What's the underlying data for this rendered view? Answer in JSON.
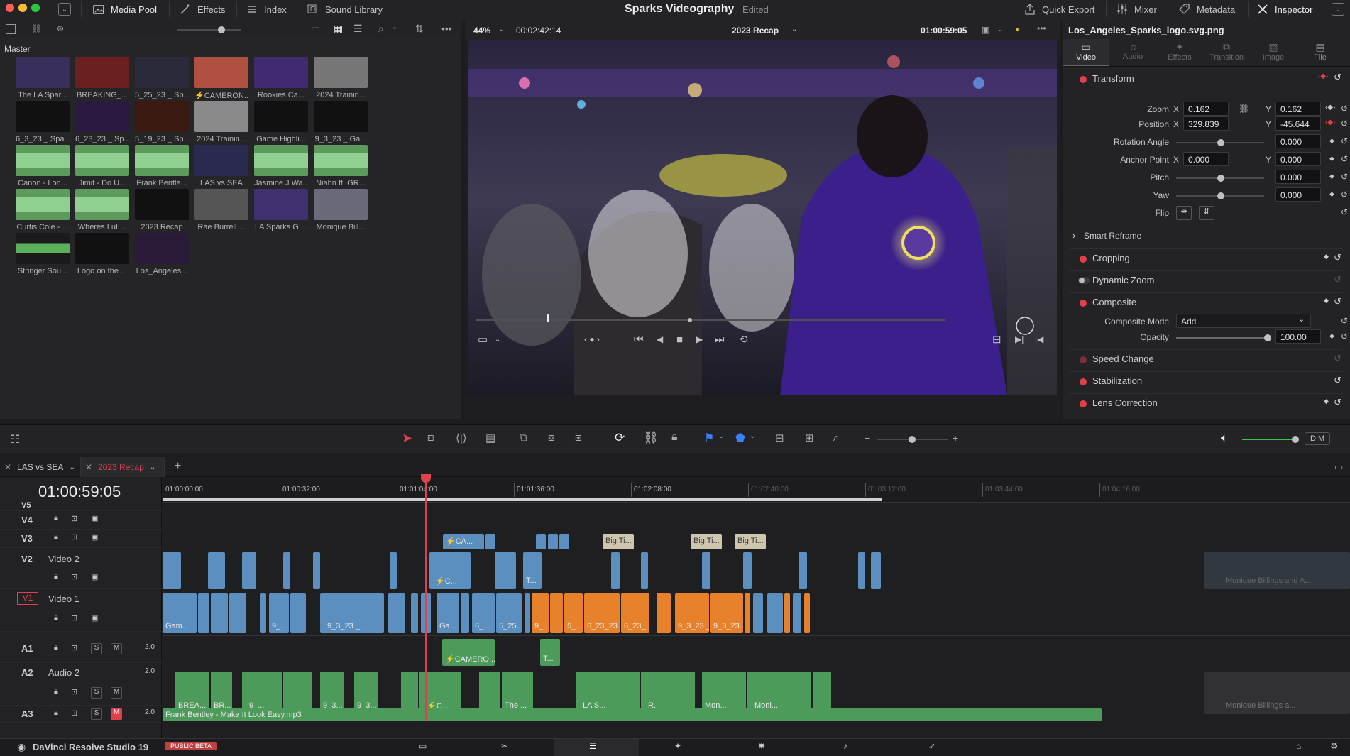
{
  "app": {
    "name": "DaVinci Resolve Studio 19",
    "badge": "PUBLIC BETA",
    "project": "Sparks Videography",
    "status": "Edited"
  },
  "topbar": {
    "media_pool": "Media Pool",
    "effects": "Effects",
    "index": "Index",
    "sound_library": "Sound Library",
    "quick_export": "Quick Export",
    "mixer": "Mixer",
    "metadata": "Metadata",
    "inspector": "Inspector"
  },
  "media_pool": {
    "bin": "Master",
    "clips": [
      {
        "label": "The LA Spar..."
      },
      {
        "label": "BREAKING_..."
      },
      {
        "label": "5_25_23 _ Sp..."
      },
      {
        "label": "⚡CAMERON..."
      },
      {
        "label": "Rookies Ca..."
      },
      {
        "label": "2024 Trainin..."
      },
      {
        "label": "6_3_23 _ Spa..."
      },
      {
        "label": "6_23_23 _ Sp..."
      },
      {
        "label": "5_19_23 _ Sp..."
      },
      {
        "label": "2024 Trainin..."
      },
      {
        "label": "Game Highli..."
      },
      {
        "label": "9_3_23 _ Ga..."
      },
      {
        "label": "Canon - Lon..."
      },
      {
        "label": "Jimit - Do U..."
      },
      {
        "label": "Frank Bentle..."
      },
      {
        "label": "LAS vs SEA"
      },
      {
        "label": "Jasmine J Wa..."
      },
      {
        "label": "Niahn ft. GR..."
      },
      {
        "label": "Curtis Cole - ..."
      },
      {
        "label": "Wheres LuL..."
      },
      {
        "label": "2023 Recap"
      },
      {
        "label": "Rae Burrell ..."
      },
      {
        "label": "LA Sparks G ..."
      },
      {
        "label": "Monique Bill..."
      },
      {
        "label": "Stringer Sou..."
      },
      {
        "label": "Logo on the ..."
      },
      {
        "label": "Los_Angeles..."
      }
    ]
  },
  "viewer": {
    "zoom": "44%",
    "duration": "00:02:42:14",
    "timeline": "2023 Recap",
    "timecode": "01:00:59:05"
  },
  "inspector": {
    "clip_name": "Los_Angeles_Sparks_logo.svg.png",
    "tabs": [
      "Video",
      "Audio",
      "Effects",
      "Transition",
      "Image",
      "File"
    ],
    "transform": "Transform",
    "zoom_label": "Zoom",
    "zoom_x": "0.162",
    "zoom_y": "0.162",
    "position_label": "Position",
    "pos_x": "329.839",
    "pos_y": "-45.644",
    "rotation_label": "Rotation Angle",
    "rotation": "0.000",
    "anchor_label": "Anchor Point",
    "anchor_x": "0.000",
    "anchor_y": "0.000",
    "pitch_label": "Pitch",
    "pitch": "0.000",
    "yaw_label": "Yaw",
    "yaw": "0.000",
    "flip_label": "Flip",
    "x": "X",
    "y": "Y",
    "smart_reframe": "Smart Reframe",
    "cropping": "Cropping",
    "dynamic_zoom": "Dynamic Zoom",
    "composite": "Composite",
    "composite_mode_label": "Composite Mode",
    "composite_mode": "Add",
    "opacity_label": "Opacity",
    "opacity": "100.00",
    "speed_change": "Speed Change",
    "stabilization": "Stabilization",
    "lens_correction": "Lens Correction"
  },
  "timeline_tabs": [
    {
      "label": "LAS vs SEA"
    },
    {
      "label": "2023 Recap"
    }
  ],
  "timeline": {
    "timecode": "01:00:59:05",
    "ruler": [
      "01:00:00:00",
      "01:00:32:00",
      "01:01:04:00",
      "01:01:36:00",
      "01:02:08:00",
      "01:02:40:00",
      "01:03:12:00",
      "01:03:44:00",
      "01:04:16:00"
    ],
    "tracks": {
      "v5": "V5",
      "v4": "V4",
      "v3": "V3",
      "v2": "V2",
      "v2_name": "Video 2",
      "v1": "V1",
      "v1_name": "Video 1",
      "a1": "A1",
      "a2": "A2",
      "a2_name": "Audio 2",
      "a3": "A3",
      "level": "2.0",
      "s": "S",
      "m": "M"
    },
    "clips": {
      "v3_cam": "⚡CA...",
      "big1": "Big Ti...",
      "big2": "Big Ti...",
      "big3": "Big Ti...",
      "v2_c": "⚡C...",
      "v2_t": "T...",
      "v1_gam": "Gam...",
      "v1_9a": "9_...",
      "v1_93": "9_3_23 _...",
      "v1_ga": "Ga...",
      "v1_6": "6_...",
      "v1_525": "5_25...",
      "v1_9b": "9_...",
      "v1_5": "5_...",
      "v1_623a": "6_23_23 ...",
      "v1_623b": "6_23_...",
      "v1_93b": "9_3_23 _...",
      "v1_93c": "9_3_23...",
      "a1_cam": "⚡CAMERO...",
      "a1_t": "T...",
      "a2_brea": "BREA...",
      "a2_br": "BR...",
      "a2_9": "9_...",
      "a2_93a": "9_3...",
      "a2_93b": "9_3...",
      "a2_c": "⚡C...",
      "a2_the": "The ...",
      "a2_las": "LA S...",
      "a2_r": "R...",
      "a2_mon": "Mon...",
      "a2_moni": "Moni...",
      "a3_frank": "Frank Bentley - Make It Look Easy.mp3",
      "ghost_v": "Monique Billings and A...",
      "ghost_a": "Monique Billings a..."
    }
  },
  "dim": "DIM",
  "colors": {
    "accent_red": "#e0404c",
    "timeline_blue": "#5a8fbf",
    "timeline_orange": "#e8822a",
    "audio_green": "#4c9b5a"
  }
}
